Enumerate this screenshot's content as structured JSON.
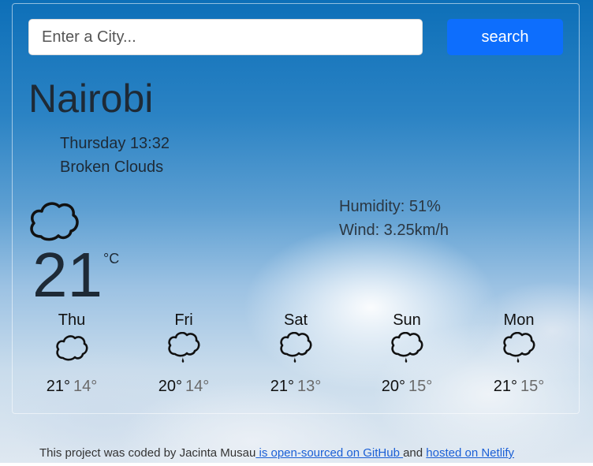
{
  "search": {
    "placeholder": "Enter a City...",
    "value": "",
    "button_label": "search"
  },
  "current": {
    "city": "Nairobi",
    "datetime": "Thursday 13:32",
    "description": "Broken Clouds",
    "icon": "cloud-icon",
    "temperature": "21",
    "unit": "°C",
    "humidity": "Humidity: 51%",
    "wind": "Wind: 3.25km/h"
  },
  "forecast": [
    {
      "day": "Thu",
      "icon": "cloud-icon",
      "max": "21°",
      "min": "14°"
    },
    {
      "day": "Fri",
      "icon": "rain-cloud-icon",
      "max": "20°",
      "min": "14°"
    },
    {
      "day": "Sat",
      "icon": "rain-cloud-icon",
      "max": "21°",
      "min": "13°"
    },
    {
      "day": "Sun",
      "icon": "rain-cloud-icon",
      "max": "20°",
      "min": "15°"
    },
    {
      "day": "Mon",
      "icon": "rain-cloud-icon",
      "max": "21°",
      "min": "15°"
    }
  ],
  "footer": {
    "text_before": "This project was coded by Jacinta Musau",
    "github_link": " is open-sourced on GitHub ",
    "text_middle": "and ",
    "netlify_link": "hosted on Netlify"
  },
  "colors": {
    "search_button": "#0d6efd",
    "text_dark": "#1e2a36",
    "link": "#1a5fd6"
  }
}
